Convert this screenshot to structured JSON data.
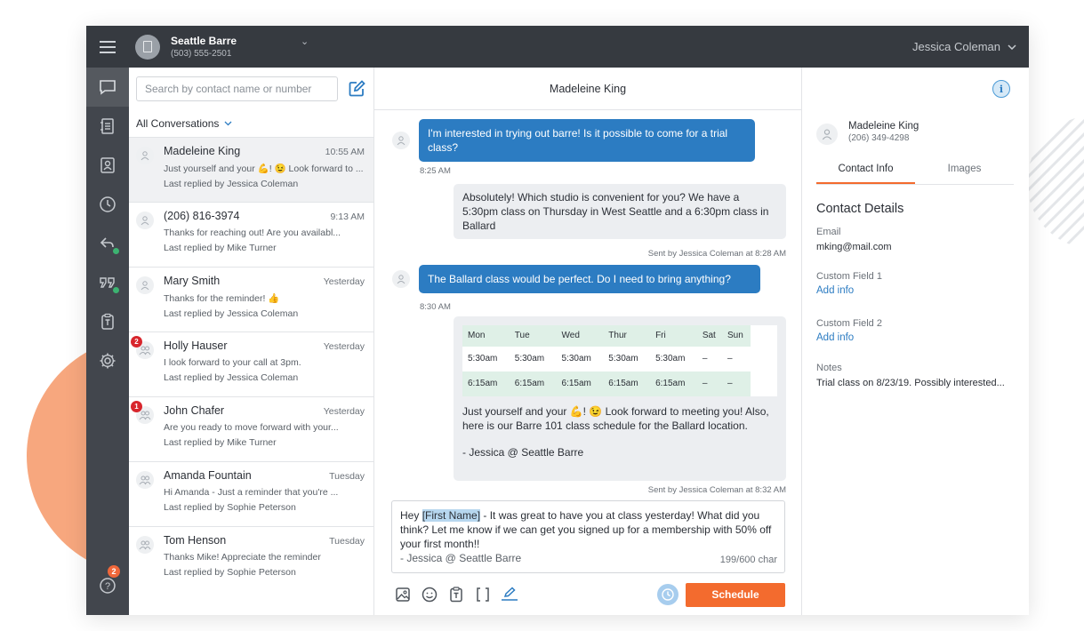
{
  "topbar": {
    "org_name": "Seattle Barre",
    "org_phone": "(503) 555-2501",
    "user_name": "Jessica Coleman"
  },
  "conversations": {
    "search_placeholder": "Search by contact name or number",
    "filter_label": "All Conversations",
    "items": [
      {
        "name": "Madeleine King",
        "time": "10:55 AM",
        "preview": "Just yourself and your 💪! 😉 Look forward to ...",
        "replied": "Last replied by Jessica Coleman"
      },
      {
        "name": "(206) 816-3974",
        "time": "9:13 AM",
        "preview": "Thanks for reaching out! Are you availabl...",
        "replied": "Last replied by Mike Turner"
      },
      {
        "name": "Mary Smith",
        "time": "Yesterday",
        "preview": "Thanks for the reminder! 👍",
        "replied": "Last replied by Jessica Coleman"
      },
      {
        "name": "Holly Hauser",
        "time": "Yesterday",
        "preview": "I look forward to your call at 3pm.",
        "replied": "Last replied by Jessica Coleman",
        "badge": "2"
      },
      {
        "name": "John Chafer",
        "time": "Yesterday",
        "preview": "Are you ready to move forward with your...",
        "replied": "Last replied by Mike Turner",
        "badge": "1"
      },
      {
        "name": "Amanda Fountain",
        "time": "Tuesday",
        "preview": "Hi Amanda - Just a reminder that you're ...",
        "replied": "Last replied by Sophie Peterson"
      },
      {
        "name": "Tom Henson",
        "time": "Tuesday",
        "preview": "Thanks Mike! Appreciate the reminder",
        "replied": "Last replied by Sophie Peterson"
      }
    ]
  },
  "chat": {
    "title": "Madeleine King",
    "messages": {
      "m1": "I'm interested in trying out barre! Is it possible to come for a trial class?",
      "t1": "8:25 AM",
      "m2": "Absolutely! Which studio is convenient for you? We have a 5:30pm class on Thursday in West Seattle and a 6:30pm class in Ballard",
      "t2": "Sent by Jessica Coleman at 8:28 AM",
      "m3": "The Ballard class would be perfect. Do I need to bring anything?",
      "t3": "8:30 AM",
      "m4_line1": "Just yourself and your 💪! 😉 Look forward to meeting you! Also, here is our Barre 101 class schedule for the Ballard location.",
      "m4_sig": "- Jessica @ Seattle Barre",
      "t4": "Sent by Jessica Coleman at 8:32 AM"
    },
    "schedule": {
      "days": [
        "Mon",
        "Tue",
        "Wed",
        "Thur",
        "Fri",
        "Sat",
        "Sun"
      ],
      "row1": [
        "5:30am",
        "5:30am",
        "5:30am",
        "5:30am",
        "5:30am",
        "–",
        "–"
      ],
      "row2": [
        "6:15am",
        "6:15am",
        "6:15am",
        "6:15am",
        "6:15am",
        "–",
        "–"
      ]
    },
    "composer": {
      "pre": "Hey ",
      "highlight": "[First Name]",
      "post": " - It was great to have you at class yesterday! What did you think? Let me know if we can get you signed up for a membership with 50% off your first month!!",
      "signature": "- Jessica @ Seattle Barre",
      "char_count": "199/600 char"
    },
    "schedule_button": "Schedule"
  },
  "contact": {
    "name": "Madeleine King",
    "phone": "(206) 349-4298",
    "tab_info": "Contact Info",
    "tab_images": "Images",
    "details_title": "Contact Details",
    "email_label": "Email",
    "email_value": "mking@mail.com",
    "custom1_label": "Custom Field 1",
    "custom1_link": "Add info",
    "custom2_label": "Custom Field 2",
    "custom2_link": "Add info",
    "notes_label": "Notes",
    "notes_value": "Trial class on 8/23/19. Possibly interested..."
  },
  "help_badge": "2",
  "colors": {
    "accent_blue": "#2c7cc2",
    "accent_orange": "#f36b2e",
    "topbar": "#363a40",
    "rail": "#42464d",
    "online_dot": "#3cb371",
    "unread_badge": "#d8262d"
  }
}
